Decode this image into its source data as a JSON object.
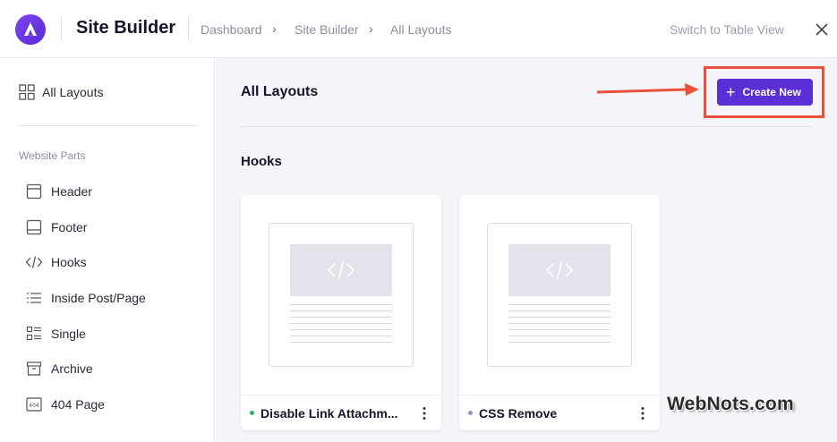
{
  "header": {
    "app_title": "Site Builder",
    "breadcrumbs": [
      "Dashboard",
      "Site Builder",
      "All Layouts"
    ],
    "switch_view_label": "Switch to Table View",
    "logo_icon": "astra-logo-icon",
    "close_icon": "close-icon"
  },
  "sidebar": {
    "all_layouts_label": "All Layouts",
    "section_label": "Website Parts",
    "items": [
      {
        "label": "Header",
        "icon": "header-icon"
      },
      {
        "label": "Footer",
        "icon": "footer-icon"
      },
      {
        "label": "Hooks",
        "icon": "code-icon"
      },
      {
        "label": "Inside Post/Page",
        "icon": "list-icon"
      },
      {
        "label": "Single",
        "icon": "single-icon"
      },
      {
        "label": "Archive",
        "icon": "archive-icon"
      },
      {
        "label": "404 Page",
        "icon": "404-icon"
      }
    ]
  },
  "main": {
    "page_title": "All Layouts",
    "create_button_label": "Create New",
    "section_title": "Hooks",
    "cards": [
      {
        "name": "Disable Link Attachm...",
        "status_color": "#2fb36b"
      },
      {
        "name": "CSS Remove",
        "status_color": "#8a9ab0"
      }
    ]
  },
  "colors": {
    "accent": "#5a2fd6",
    "highlight": "#e8503a"
  },
  "watermark": "WebNots.com"
}
